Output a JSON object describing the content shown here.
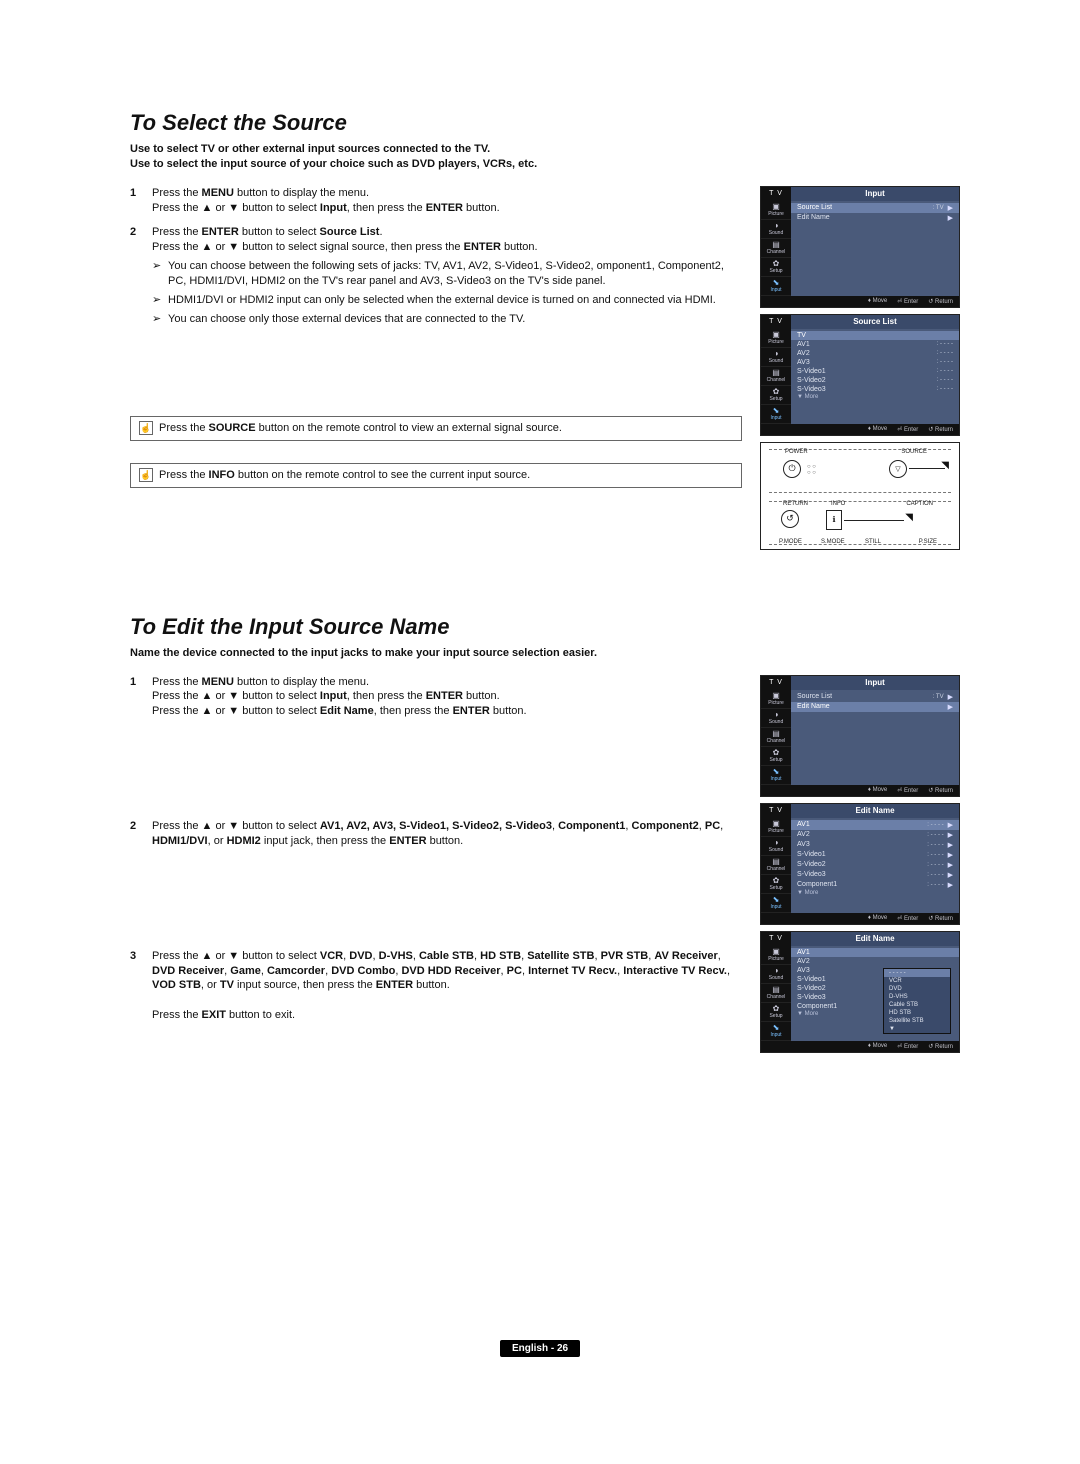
{
  "section1": {
    "heading": "To Select the Source",
    "intro1": "Use to select TV or other external input sources connected to the TV.",
    "intro2": "Use to select the input source of your choice such as DVD players, VCRs, etc.",
    "step1a": "Press the ",
    "step1b": " button to display the menu.",
    "step1c": "Press the ▲ or ▼ button to select ",
    "step1d": ", then press the ",
    "step1e": " button.",
    "step2a": "Press the ",
    "step2b": " button to select ",
    "step2c": "Press the ▲ or ▼ button to select signal source, then press the ",
    "step2d": " button.",
    "bullet1": "You can choose between the following sets of jacks: TV, AV1, AV2, S-Video1, S-Video2, omponent1, Component2, PC, HDMI1/DVI, HDMI2 on the TV's rear panel and AV3, S-Video3 on the TV's side panel.",
    "bullet2": "HDMI1/DVI or HDMI2 input can only be selected when the external device is turned on and connected via HDMI.",
    "bullet3": "You can choose only those external devices that are connected to the TV.",
    "note1a": "Press the ",
    "note1b": " button on the remote control to view an external signal source.",
    "note2a": "Press the ",
    "note2b": " button on the remote control to see the current input source.",
    "menu_btn": "MENU",
    "enter_btn": "ENTER",
    "input_lbl": "Input",
    "source_btn": "SOURCE",
    "info_btn": "INFO",
    "source_list_lbl": "Source List"
  },
  "section2": {
    "heading": "To Edit the Input Source Name",
    "intro": "Name the device connected to the input jacks to make your input source selection easier.",
    "step1a": "Press the ",
    "step1b1": " button to display the menu.",
    "step1c": "Press the ▲ or ▼ button to select ",
    "step1d": ", then press the ",
    "step1e": " button.",
    "step1f": "Press the ▲ or ▼ button to select ",
    "step1g": ", then press the ",
    "step1h": " button.",
    "step2a": "Press the ▲ or ▼ button to select ",
    "step2b": " input jack, then press the ",
    "step2c": " button.",
    "step2_inputs": "AV1, AV2, AV3,  S-Video1, S-Video2, S-Video3",
    "step2_inputs2": "Component1",
    "step2_inputs3": "Component2",
    "step2_inputs4": "PC",
    "step2_inputs5": "HDMI1/DVI",
    "step2_inputs6": "HDMI2",
    "step3a": "Press the ▲ or ▼ button to select ",
    "step3b": " input source, then press the ",
    "step3c": " button.",
    "step3_list1": "VCR",
    "step3_list2": "DVD",
    "step3_list3": "D-VHS",
    "step3_list4": "Cable STB",
    "step3_list5": "HD STB",
    "step3_list6": "Satellite STB",
    "step3_list7": "PVR STB",
    "step3_list8": "AV Receiver",
    "step3_list9": "DVD Receiver",
    "step3_list10": "Game",
    "step3_list11": "Camcorder",
    "step3_list12": "DVD Combo",
    "step3_list13": "DVD HDD Receiver",
    "step3_list14": "PC",
    "step3_list15": "Internet TV Recv.",
    "step3_list16": "Interactive TV Recv.",
    "step3_list17": "VOD STB",
    "step3_list18": "TV",
    "exit_line_a": "Press the ",
    "exit_line_b": " button to exit.",
    "menu_btn": "MENU",
    "enter_btn": "ENTER",
    "input_lbl": "Input",
    "edit_name_lbl": "Edit Name",
    "exit_btn": "EXIT"
  },
  "osd_sidebar": [
    "Picture",
    "Sound",
    "Channel",
    "Setup",
    "Input"
  ],
  "osd_side_icons": [
    "▣",
    "◑",
    "▤",
    "✿",
    "⬊"
  ],
  "osd1": {
    "title": "Input",
    "rows": [
      {
        "l": "Source List",
        "v": ": TV",
        "sel": true,
        "arrow": true
      },
      {
        "l": "Edit Name",
        "v": "",
        "sel": false,
        "arrow": true
      }
    ]
  },
  "osd2": {
    "title": "Source List",
    "rows": [
      {
        "l": "TV",
        "v": "",
        "sel": true
      },
      {
        "l": "AV1",
        "v": ": - - - -"
      },
      {
        "l": "AV2",
        "v": ": - - - -"
      },
      {
        "l": "AV3",
        "v": ": - - - -"
      },
      {
        "l": "S-Video1",
        "v": ": - - - -"
      },
      {
        "l": "S-Video2",
        "v": ": - - - -"
      },
      {
        "l": "S-Video3",
        "v": ": - - - -"
      }
    ],
    "more": "▼ More"
  },
  "osd3": {
    "title": "Input",
    "rows": [
      {
        "l": "Source List",
        "v": ": TV",
        "arrow": true
      },
      {
        "l": "Edit Name",
        "v": "",
        "sel": true,
        "arrow": true
      }
    ]
  },
  "osd4": {
    "title": "Edit Name",
    "rows": [
      {
        "l": "AV1",
        "v": ": - - - -",
        "sel": true,
        "arrow": true
      },
      {
        "l": "AV2",
        "v": ": - - - -",
        "arrow": true
      },
      {
        "l": "AV3",
        "v": ": - - - -",
        "arrow": true
      },
      {
        "l": "S-Video1",
        "v": ": - - - -",
        "arrow": true
      },
      {
        "l": "S-Video2",
        "v": ": - - - -",
        "arrow": true
      },
      {
        "l": "S-Video3",
        "v": ": - - - -",
        "arrow": true
      },
      {
        "l": "Component1",
        "v": ": - - - -",
        "arrow": true
      }
    ],
    "more": "▼ More"
  },
  "osd5": {
    "title": "Edit Name",
    "rows": [
      {
        "l": "AV1",
        "v": "",
        "sel": true
      },
      {
        "l": "AV2",
        "v": ""
      },
      {
        "l": "AV3",
        "v": ""
      },
      {
        "l": "S-Video1",
        "v": ""
      },
      {
        "l": "S-Video2",
        "v": ""
      },
      {
        "l": "S-Video3",
        "v": ""
      },
      {
        "l": "Component1",
        "v": ""
      }
    ],
    "more": "▼ More",
    "popup": [
      "- - - - -",
      "VCR",
      "DVD",
      "D-VHS",
      "Cable STB",
      "HD STB",
      "Satellite STB",
      "▼"
    ]
  },
  "osd_foot": {
    "move": "♦ Move",
    "enter": "⏎ Enter",
    "return": "↺ Return"
  },
  "remote": {
    "power": "POWER",
    "source": "SOURCE",
    "return": "RETURN",
    "info": "INFO",
    "caption": "CAPTION",
    "pmode": "P.MODE",
    "smode": "S.MODE",
    "still": "STILL",
    "psize": "P.SIZE"
  },
  "footer": "English - 26",
  "sep_comma": ", ",
  "sep_or": ", or "
}
